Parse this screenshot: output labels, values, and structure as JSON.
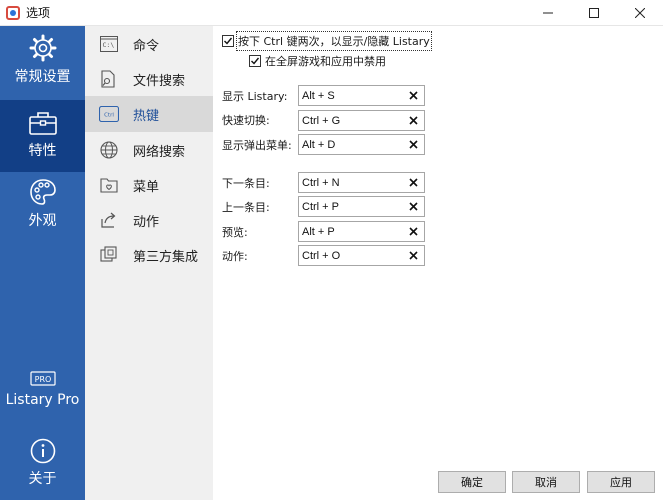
{
  "window": {
    "title": "选项",
    "icon": "listary-app-icon"
  },
  "window_controls": {
    "minimize": "—",
    "maximize": "☐",
    "close": "✕"
  },
  "sidebar": {
    "items": [
      {
        "label": "常规设置",
        "icon": "gear-icon"
      },
      {
        "label": "特性",
        "icon": "toolbox-icon",
        "active": true
      },
      {
        "label": "外观",
        "icon": "palette-icon"
      },
      {
        "label": "Listary Pro",
        "icon": "pro-badge-icon"
      },
      {
        "label": "关于",
        "icon": "info-icon"
      }
    ],
    "pro_badge": "PRO"
  },
  "nav": {
    "items": [
      {
        "label": "命令",
        "icon": "command-prompt-icon"
      },
      {
        "label": "文件搜索",
        "icon": "file-search-icon"
      },
      {
        "label": "热键",
        "icon": "keyboard-ctrl-icon",
        "active": true
      },
      {
        "label": "网络搜索",
        "icon": "globe-icon"
      },
      {
        "label": "菜单",
        "icon": "menu-folder-icon"
      },
      {
        "label": "动作",
        "icon": "share-arrow-icon"
      },
      {
        "label": "第三方集成",
        "icon": "integration-icon"
      }
    ],
    "ctrl_key_glyph": "Ctrl",
    "cmd_glyph": "C:\\"
  },
  "settings": {
    "double_ctrl": {
      "label": "按下 Ctrl 键两次，以显示/隐藏 Listary",
      "checked": true
    },
    "disable_fullscreen": {
      "label": "在全屏游戏和应用中禁用",
      "checked": true
    },
    "hotkeys": [
      {
        "label": "显示 Listary:",
        "value": "Alt + S"
      },
      {
        "label": "快速切换:",
        "value": "Ctrl + G"
      },
      {
        "label": "显示弹出菜单:",
        "value": "Alt + D"
      },
      {
        "label": "下一条目:",
        "value": "Ctrl + N"
      },
      {
        "label": "上一条目:",
        "value": "Ctrl + P"
      },
      {
        "label": "预览:",
        "value": "Alt + P"
      },
      {
        "label": "动作:",
        "value": "Ctrl + O"
      }
    ]
  },
  "buttons": {
    "ok": "确定",
    "cancel": "取消",
    "apply": "应用"
  }
}
